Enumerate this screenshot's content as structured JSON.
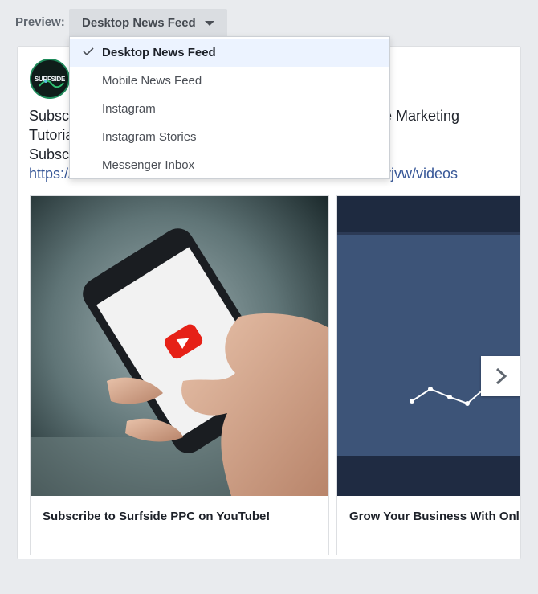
{
  "preview": {
    "label": "Preview:",
    "selected": "Desktop News Feed"
  },
  "menu": {
    "items": [
      {
        "label": "Desktop News Feed",
        "selected": true
      },
      {
        "label": "Mobile News Feed",
        "selected": false
      },
      {
        "label": "Instagram",
        "selected": false
      },
      {
        "label": "Instagram Stories",
        "selected": false
      },
      {
        "label": "Messenger Inbox",
        "selected": false
      }
    ]
  },
  "post": {
    "page_name": "SURFSIDE",
    "text_line1_start": "Subscr",
    "text_line1_end": "ee Marketing",
    "text_line2_start": "Tutoria",
    "text_line3_start": "Subscr",
    "link_start": "https://",
    "link_end": "rjvw/videos",
    "carousel": [
      {
        "caption": "Subscribe to Surfside PPC on YouTube!"
      },
      {
        "caption": "Grow Your Business With Onli"
      }
    ]
  },
  "colors": {
    "background": "#e9ebee",
    "link": "#385898",
    "youtube_red": "#e62117",
    "selected_bg": "#ecf3ff"
  }
}
